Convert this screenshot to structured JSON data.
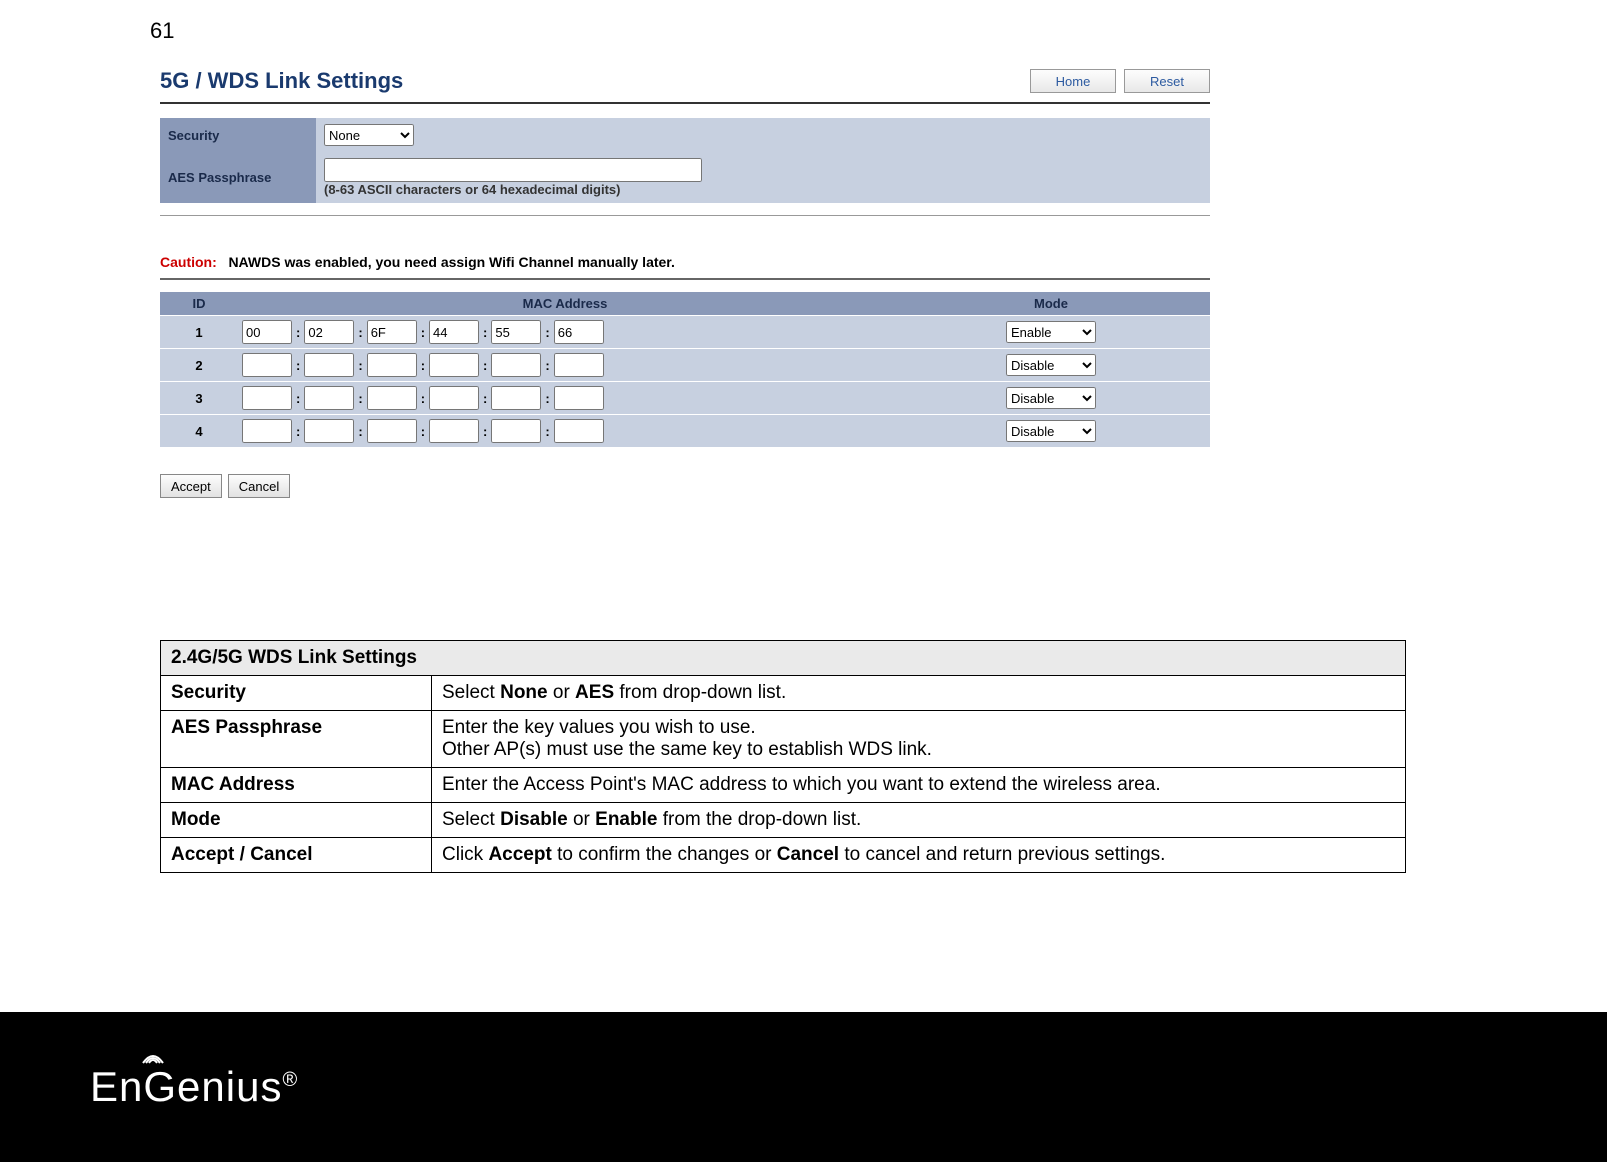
{
  "page_number": "61",
  "router": {
    "title": "5G / WDS Link Settings",
    "header_buttons": {
      "home": "Home",
      "reset": "Reset"
    },
    "security": {
      "label": "Security",
      "selected": "None",
      "options": [
        "None",
        "AES"
      ]
    },
    "aes": {
      "label": "AES Passphrase",
      "value": "",
      "hint": "(8-63 ASCII characters or 64 hexadecimal digits)"
    },
    "caution": {
      "label": "Caution:",
      "text": "NAWDS was enabled, you need assign Wifi Channel manually later."
    },
    "mac_table": {
      "headers": {
        "id": "ID",
        "mac": "MAC Address",
        "mode": "Mode"
      },
      "mode_options": [
        "Enable",
        "Disable"
      ],
      "rows": [
        {
          "id": "1",
          "octets": [
            "00",
            "02",
            "6F",
            "44",
            "55",
            "66"
          ],
          "mode": "Enable"
        },
        {
          "id": "2",
          "octets": [
            "",
            "",
            "",
            "",
            "",
            ""
          ],
          "mode": "Disable"
        },
        {
          "id": "3",
          "octets": [
            "",
            "",
            "",
            "",
            "",
            ""
          ],
          "mode": "Disable"
        },
        {
          "id": "4",
          "octets": [
            "",
            "",
            "",
            "",
            "",
            ""
          ],
          "mode": "Disable"
        }
      ]
    },
    "actions": {
      "accept": "Accept",
      "cancel": "Cancel"
    }
  },
  "help": {
    "title": "2.4G/5G WDS Link Settings",
    "rows": [
      {
        "label": "Security",
        "desc_parts": [
          "Select ",
          "None",
          " or ",
          "AES",
          " from drop-down list."
        ]
      },
      {
        "label": "AES Passphrase",
        "desc_line1": "Enter the key values you wish to use.",
        "desc_line2": "Other AP(s) must use the same key to establish WDS link."
      },
      {
        "label": "MAC Address",
        "desc_plain": "Enter the Access Point's MAC address to which you want to extend the wireless area."
      },
      {
        "label": "Mode",
        "desc_parts": [
          "Select ",
          "Disable",
          " or ",
          "Enable",
          " from the drop-down list."
        ]
      },
      {
        "label": "Accept / Cancel",
        "desc_parts": [
          "Click ",
          "Accept",
          " to confirm the changes or ",
          "Cancel",
          " to cancel and return previous settings."
        ]
      }
    ]
  },
  "footer": {
    "brand_pre": "En",
    "brand_post": "enius",
    "reg": "®"
  }
}
